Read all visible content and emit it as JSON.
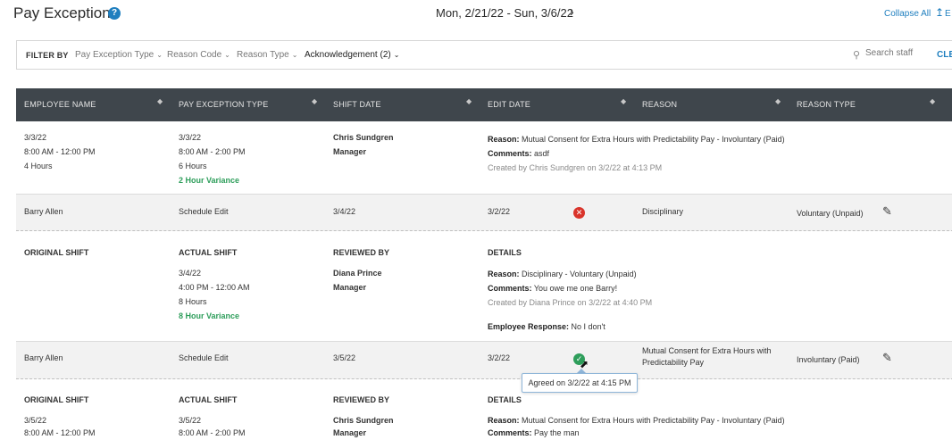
{
  "header": {
    "title": "Pay Exceptions",
    "help_glyph": "?",
    "date_range": "Mon, 2/21/22 - Sun, 3/6/22",
    "next_glyph": "›",
    "collapse_all": "Collapse All",
    "export_glyph": "↥",
    "export_label": "E"
  },
  "filters": {
    "label": "FILTER BY",
    "items": [
      "Pay Exception Type",
      "Reason Code",
      "Reason Type",
      "Acknowledgement (2)"
    ],
    "chevron": "⌄",
    "search_placeholder": "Search staff",
    "clear": "CLEA"
  },
  "columns": [
    "EMPLOYEE NAME",
    "PAY EXCEPTION TYPE",
    "SHIFT DATE",
    "EDIT DATE",
    "REASON",
    "REASON TYPE"
  ],
  "sort_glyph": "◆",
  "detail1": {
    "col1": [
      "3/3/22",
      "8:00 AM - 12:00 PM",
      "4 Hours"
    ],
    "col2": [
      "3/3/22",
      "8:00 AM - 2:00 PM",
      "6 Hours"
    ],
    "variance": "2 Hour Variance",
    "reviewer": "Chris Sundgren",
    "reviewer_role": "Manager",
    "reason_label": "Reason:",
    "reason": "Mutual Consent for Extra Hours with Predictability Pay - Involuntary (Paid)",
    "comments_label": "Comments:",
    "comments": "asdf",
    "created": "Created by Chris Sundgren on 3/2/22 at 4:13 PM"
  },
  "row1": {
    "employee": "Barry Allen",
    "type": "Schedule Edit",
    "shift_date": "3/4/22",
    "edit_date": "3/2/22",
    "status_glyph": "✕",
    "reason": "Disciplinary",
    "reason_type": "Voluntary (Unpaid)",
    "edit_glyph": "✎"
  },
  "detail2": {
    "headers": [
      "ORIGINAL SHIFT",
      "ACTUAL SHIFT",
      "REVIEWED BY",
      "DETAILS"
    ],
    "actual": [
      "3/4/22",
      "4:00 PM - 12:00 AM",
      "8 Hours"
    ],
    "variance": "8 Hour Variance",
    "reviewer": "Diana Prince",
    "reviewer_role": "Manager",
    "reason_label": "Reason:",
    "reason": "Disciplinary - Voluntary (Unpaid)",
    "comments_label": "Comments:",
    "comments": "You owe me one Barry!",
    "created": "Created by Diana Prince on 3/2/22 at 4:40 PM",
    "response_label": "Employee Response:",
    "response": "No I don't"
  },
  "row2": {
    "employee": "Barry Allen",
    "type": "Schedule Edit",
    "shift_date": "3/5/22",
    "edit_date": "3/2/22",
    "status_glyph": "✓",
    "reason_line1": "Mutual Consent for Extra Hours with",
    "reason_line2": "Predictability Pay",
    "reason_type": "Involuntary (Paid)",
    "edit_glyph": "✎",
    "tooltip": "Agreed on 3/2/22 at 4:15 PM"
  },
  "detail3": {
    "headers": [
      "ORIGINAL SHIFT",
      "ACTUAL SHIFT",
      "REVIEWED BY",
      "DETAILS"
    ],
    "original": [
      "3/5/22",
      "8:00 AM - 12:00 PM"
    ],
    "actual": [
      "3/5/22",
      "8:00 AM - 2:00 PM"
    ],
    "reviewer": "Chris Sundgren",
    "reviewer_role": "Manager",
    "reason_label": "Reason:",
    "reason": "Mutual Consent for Extra Hours with Predictability Pay - Involuntary (Paid)",
    "comments_label": "Comments:",
    "comments": "Pay the man"
  },
  "colors": {
    "accent": "#1f7fbf",
    "header_bg": "#3f464c",
    "variance": "#2e9e5b",
    "error": "#d9342b"
  }
}
